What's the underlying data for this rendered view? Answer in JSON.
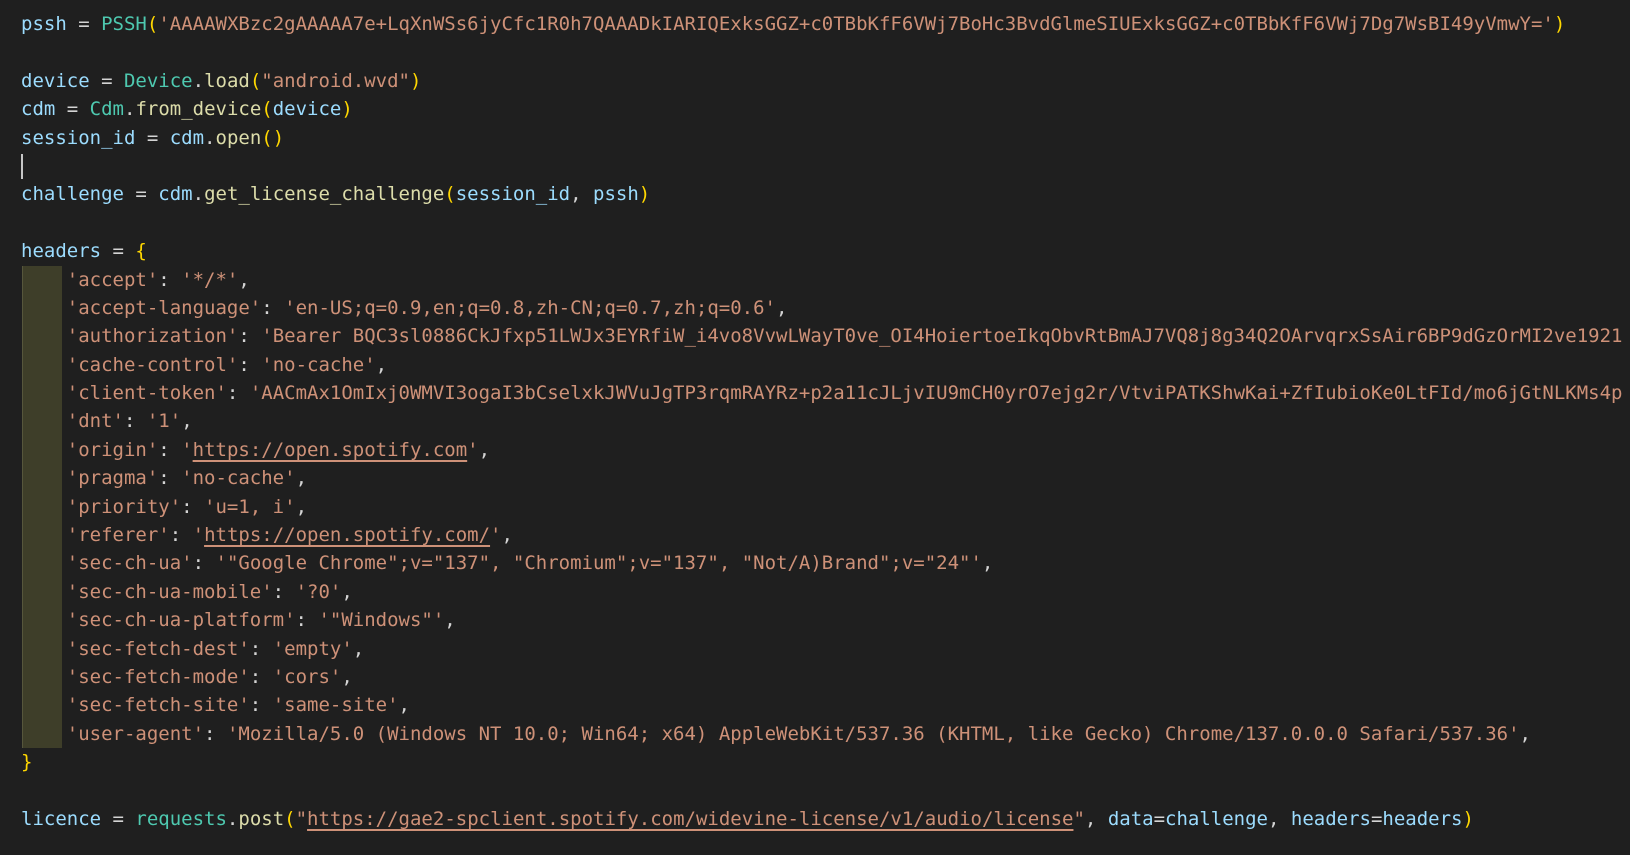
{
  "editor": {
    "app": "code-editor",
    "language": "python",
    "background": "#1f1f1f",
    "token_colors": {
      "v": "#9CDCFE",
      "c": "#4EC9B0",
      "f": "#DCDCAA",
      "s": "#CE9178",
      "su": "#CE9178",
      "p": "#D4D4D4",
      "b": "#FFD700"
    },
    "indent_highlight_color": "#3e3e29",
    "cursor": {
      "line": 6,
      "column": 0,
      "color": "#c6c6c6"
    },
    "lines": [
      {
        "seg": [
          [
            "pssh",
            "v"
          ],
          [
            " = ",
            "p"
          ],
          [
            "PSSH",
            "c"
          ],
          [
            "(",
            "b"
          ],
          [
            "'AAAAWXBzc2gAAAAA7e+LqXnWSs6jyCfc1R0h7QAAADkIARIQExksGGZ+c0TBbKfF6VWj7BoHc3BvdGlmeSIUExksGGZ+c0TBbKfF6VWj7Dg7WsBI49yVmwY='",
            "s"
          ],
          [
            ")",
            "b"
          ]
        ]
      },
      {
        "seg": []
      },
      {
        "seg": [
          [
            "device",
            "v"
          ],
          [
            " = ",
            "p"
          ],
          [
            "Device",
            "c"
          ],
          [
            ".",
            "p"
          ],
          [
            "load",
            "f"
          ],
          [
            "(",
            "b"
          ],
          [
            "\"android.wvd\"",
            "s"
          ],
          [
            ")",
            "b"
          ]
        ]
      },
      {
        "seg": [
          [
            "cdm",
            "v"
          ],
          [
            " = ",
            "p"
          ],
          [
            "Cdm",
            "c"
          ],
          [
            ".",
            "p"
          ],
          [
            "from_device",
            "f"
          ],
          [
            "(",
            "b"
          ],
          [
            "device",
            "v"
          ],
          [
            ")",
            "b"
          ]
        ]
      },
      {
        "seg": [
          [
            "session_id",
            "v"
          ],
          [
            " = ",
            "p"
          ],
          [
            "cdm",
            "v"
          ],
          [
            ".",
            "p"
          ],
          [
            "open",
            "f"
          ],
          [
            "(",
            "b"
          ],
          [
            ")",
            "b"
          ]
        ]
      },
      {
        "seg": [],
        "cursor": true
      },
      {
        "seg": [
          [
            "challenge",
            "v"
          ],
          [
            " = ",
            "p"
          ],
          [
            "cdm",
            "v"
          ],
          [
            ".",
            "p"
          ],
          [
            "get_license_challenge",
            "f"
          ],
          [
            "(",
            "b"
          ],
          [
            "session_id",
            "v"
          ],
          [
            ", ",
            "p"
          ],
          [
            "pssh",
            "v"
          ],
          [
            ")",
            "b"
          ]
        ]
      },
      {
        "seg": []
      },
      {
        "seg": [
          [
            "headers",
            "v"
          ],
          [
            " = ",
            "p"
          ],
          [
            "{",
            "b"
          ]
        ]
      },
      {
        "indent_highlight": true,
        "seg": [
          [
            "    ",
            "p"
          ],
          [
            "'accept'",
            "s"
          ],
          [
            ": ",
            "p"
          ],
          [
            "'*/*'",
            "s"
          ],
          [
            ",",
            "p"
          ]
        ]
      },
      {
        "indent_highlight": true,
        "seg": [
          [
            "    ",
            "p"
          ],
          [
            "'accept-language'",
            "s"
          ],
          [
            ": ",
            "p"
          ],
          [
            "'en-US;q=0.9,en;q=0.8,zh-CN;q=0.7,zh;q=0.6'",
            "s"
          ],
          [
            ",",
            "p"
          ]
        ]
      },
      {
        "indent_highlight": true,
        "seg": [
          [
            "    ",
            "p"
          ],
          [
            "'authorization'",
            "s"
          ],
          [
            ": ",
            "p"
          ],
          [
            "'Bearer BQC3sl0886CkJfxp51LWJx3EYRfiW_i4vo8VvwLWayT0ve_OI4HoiertoeIkqObvRtBmAJ7VQ8j8g34Q2OArvqrxSsAir6BP9dGzOrMI2ve1921",
            "s"
          ]
        ]
      },
      {
        "indent_highlight": true,
        "seg": [
          [
            "    ",
            "p"
          ],
          [
            "'cache-control'",
            "s"
          ],
          [
            ": ",
            "p"
          ],
          [
            "'no-cache'",
            "s"
          ],
          [
            ",",
            "p"
          ]
        ]
      },
      {
        "indent_highlight": true,
        "seg": [
          [
            "    ",
            "p"
          ],
          [
            "'client-token'",
            "s"
          ],
          [
            ": ",
            "p"
          ],
          [
            "'AACmAx1OmIxj0WMVI3ogaI3bCselxkJWVuJgTP3rqmRAYRz+p2a11cJLjvIU9mCH0yrO7ejg2r/VtviPATKShwKai+ZfIubioKe0LtFId/mo6jGtNLKMs4p",
            "s"
          ]
        ]
      },
      {
        "indent_highlight": true,
        "seg": [
          [
            "    ",
            "p"
          ],
          [
            "'dnt'",
            "s"
          ],
          [
            ": ",
            "p"
          ],
          [
            "'1'",
            "s"
          ],
          [
            ",",
            "p"
          ]
        ]
      },
      {
        "indent_highlight": true,
        "seg": [
          [
            "    ",
            "p"
          ],
          [
            "'origin'",
            "s"
          ],
          [
            ": ",
            "p"
          ],
          [
            "'",
            "s"
          ],
          [
            "https://open.spotify.com",
            "su"
          ],
          [
            "'",
            "s"
          ],
          [
            ",",
            "p"
          ]
        ]
      },
      {
        "indent_highlight": true,
        "seg": [
          [
            "    ",
            "p"
          ],
          [
            "'pragma'",
            "s"
          ],
          [
            ": ",
            "p"
          ],
          [
            "'no-cache'",
            "s"
          ],
          [
            ",",
            "p"
          ]
        ]
      },
      {
        "indent_highlight": true,
        "seg": [
          [
            "    ",
            "p"
          ],
          [
            "'priority'",
            "s"
          ],
          [
            ": ",
            "p"
          ],
          [
            "'u=1, i'",
            "s"
          ],
          [
            ",",
            "p"
          ]
        ]
      },
      {
        "indent_highlight": true,
        "seg": [
          [
            "    ",
            "p"
          ],
          [
            "'referer'",
            "s"
          ],
          [
            ": ",
            "p"
          ],
          [
            "'",
            "s"
          ],
          [
            "https://open.spotify.com/",
            "su"
          ],
          [
            "'",
            "s"
          ],
          [
            ",",
            "p"
          ]
        ]
      },
      {
        "indent_highlight": true,
        "seg": [
          [
            "    ",
            "p"
          ],
          [
            "'sec-ch-ua'",
            "s"
          ],
          [
            ": ",
            "p"
          ],
          [
            "'\"Google Chrome\";v=\"137\", \"Chromium\";v=\"137\", \"Not/A)Brand\";v=\"24\"'",
            "s"
          ],
          [
            ",",
            "p"
          ]
        ]
      },
      {
        "indent_highlight": true,
        "seg": [
          [
            "    ",
            "p"
          ],
          [
            "'sec-ch-ua-mobile'",
            "s"
          ],
          [
            ": ",
            "p"
          ],
          [
            "'?0'",
            "s"
          ],
          [
            ",",
            "p"
          ]
        ]
      },
      {
        "indent_highlight": true,
        "seg": [
          [
            "    ",
            "p"
          ],
          [
            "'sec-ch-ua-platform'",
            "s"
          ],
          [
            ": ",
            "p"
          ],
          [
            "'\"Windows\"'",
            "s"
          ],
          [
            ",",
            "p"
          ]
        ]
      },
      {
        "indent_highlight": true,
        "seg": [
          [
            "    ",
            "p"
          ],
          [
            "'sec-fetch-dest'",
            "s"
          ],
          [
            ": ",
            "p"
          ],
          [
            "'empty'",
            "s"
          ],
          [
            ",",
            "p"
          ]
        ]
      },
      {
        "indent_highlight": true,
        "seg": [
          [
            "    ",
            "p"
          ],
          [
            "'sec-fetch-mode'",
            "s"
          ],
          [
            ": ",
            "p"
          ],
          [
            "'cors'",
            "s"
          ],
          [
            ",",
            "p"
          ]
        ]
      },
      {
        "indent_highlight": true,
        "seg": [
          [
            "    ",
            "p"
          ],
          [
            "'sec-fetch-site'",
            "s"
          ],
          [
            ": ",
            "p"
          ],
          [
            "'same-site'",
            "s"
          ],
          [
            ",",
            "p"
          ]
        ]
      },
      {
        "indent_highlight": true,
        "seg": [
          [
            "    ",
            "p"
          ],
          [
            "'user-agent'",
            "s"
          ],
          [
            ": ",
            "p"
          ],
          [
            "'Mozilla/5.0 (Windows NT 10.0; Win64; x64) AppleWebKit/537.36 (KHTML, like Gecko) Chrome/137.0.0.0 Safari/537.36'",
            "s"
          ],
          [
            ",",
            "p"
          ]
        ]
      },
      {
        "seg": [
          [
            "}",
            "b"
          ]
        ]
      },
      {
        "seg": []
      },
      {
        "seg": [
          [
            "licence",
            "v"
          ],
          [
            " = ",
            "p"
          ],
          [
            "requests",
            "c"
          ],
          [
            ".",
            "p"
          ],
          [
            "post",
            "f"
          ],
          [
            "(",
            "b"
          ],
          [
            "\"",
            "s"
          ],
          [
            "https://gae2-spclient.spotify.com/widevine-license/v1/audio/license",
            "su"
          ],
          [
            "\"",
            "s"
          ],
          [
            ", ",
            "p"
          ],
          [
            "data",
            "v"
          ],
          [
            "=",
            "p"
          ],
          [
            "challenge",
            "v"
          ],
          [
            ", ",
            "p"
          ],
          [
            "headers",
            "v"
          ],
          [
            "=",
            "p"
          ],
          [
            "headers",
            "v"
          ],
          [
            ")",
            "b"
          ]
        ]
      }
    ]
  }
}
